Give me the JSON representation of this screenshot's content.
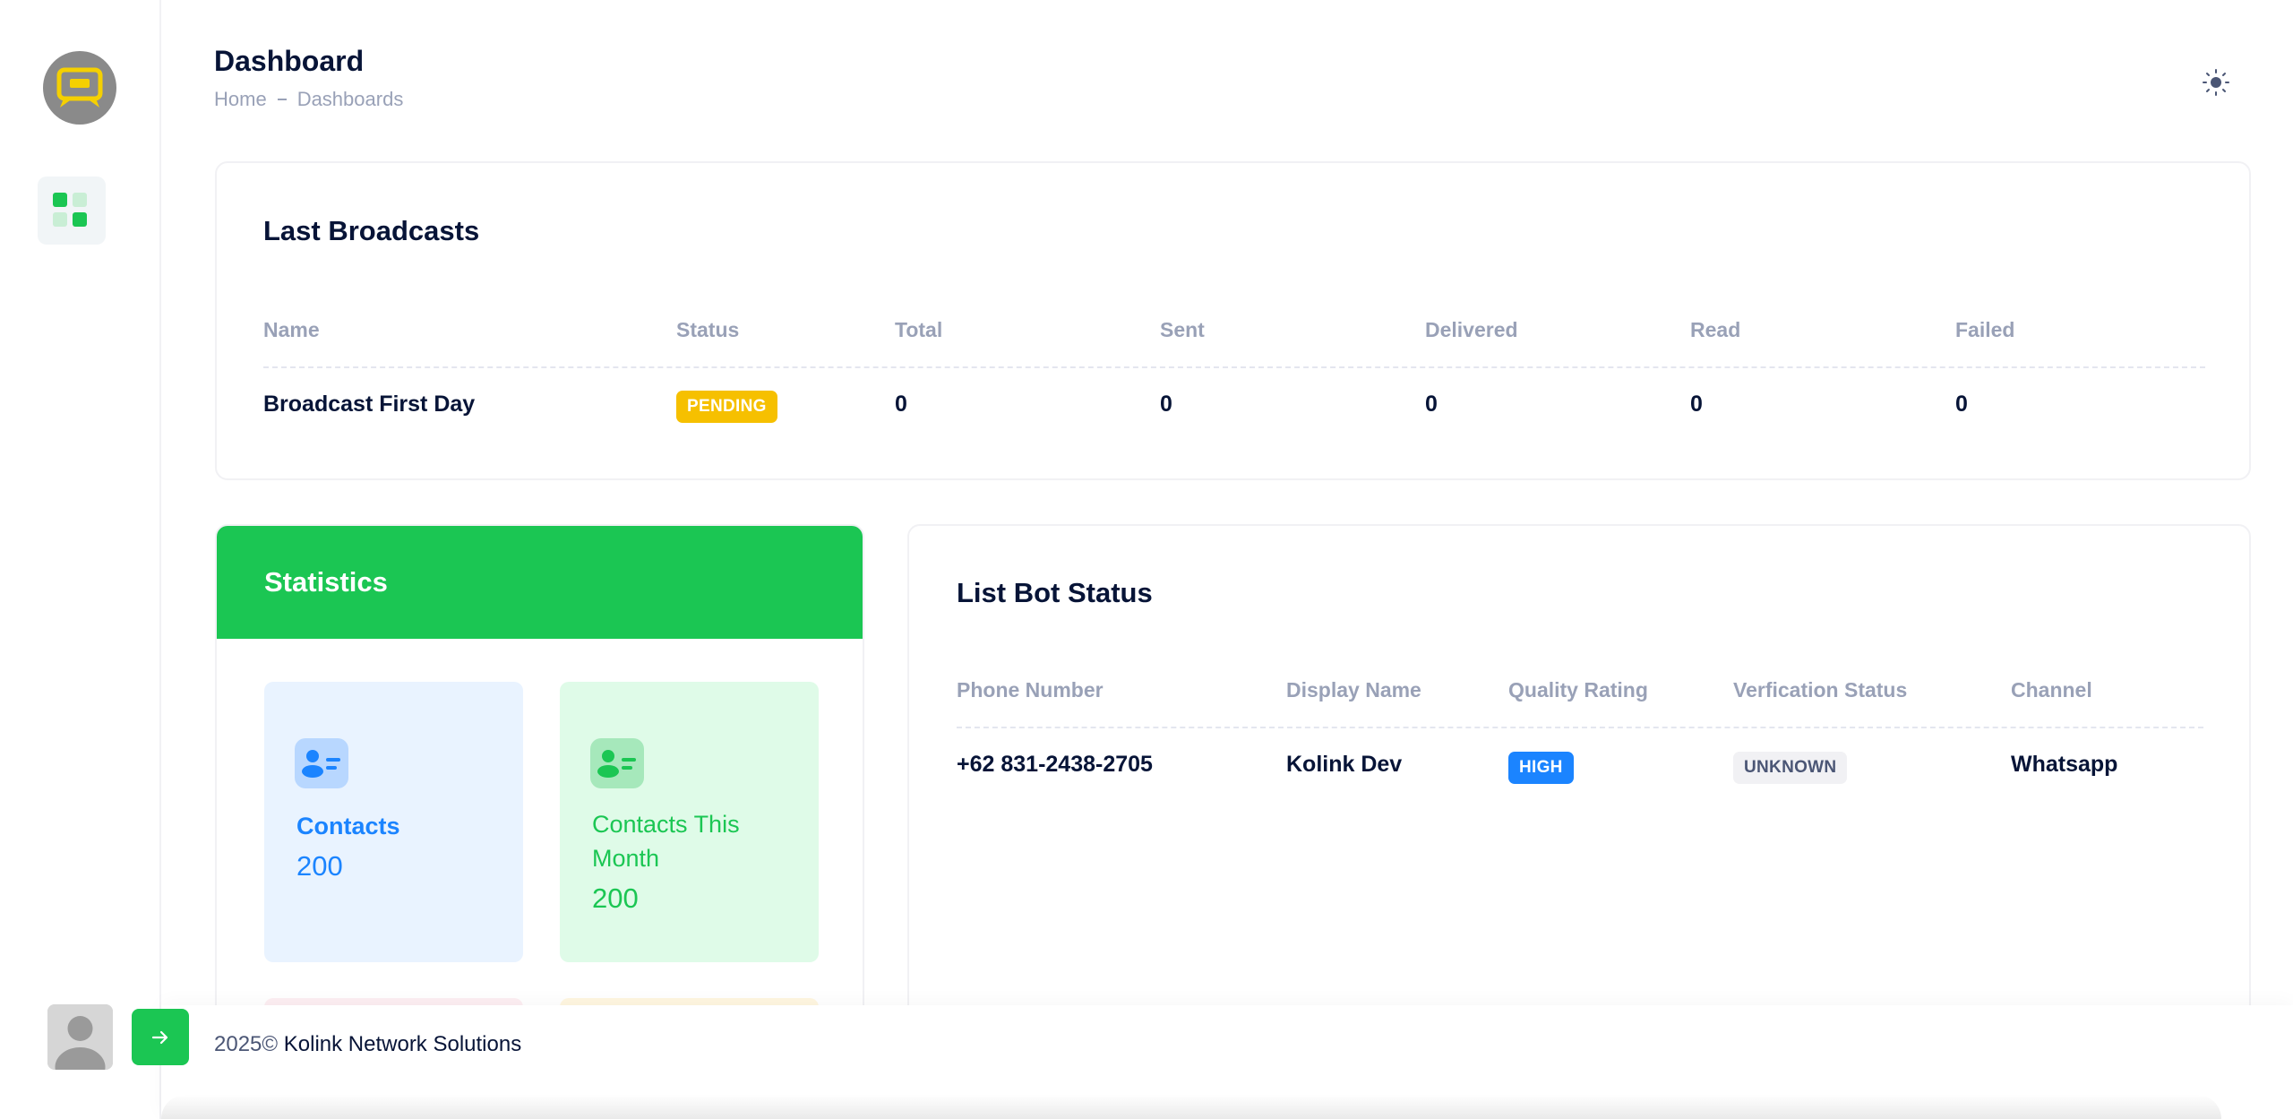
{
  "header": {
    "title": "Dashboard",
    "breadcrumb": [
      "Home",
      "Dashboards"
    ]
  },
  "broadcasts": {
    "title": "Last Broadcasts",
    "columns": [
      "Name",
      "Status",
      "Total",
      "Sent",
      "Delivered",
      "Read",
      "Failed"
    ],
    "rows": [
      {
        "name": "Broadcast First Day",
        "status": "PENDING",
        "total": "0",
        "sent": "0",
        "delivered": "0",
        "read": "0",
        "failed": "0"
      }
    ]
  },
  "statistics": {
    "title": "Statistics",
    "tiles": [
      {
        "label": "Contacts",
        "value": "200",
        "icon": "contact-card-icon"
      },
      {
        "label": "Contacts This Month",
        "value": "200",
        "icon": "contact-card-icon"
      }
    ]
  },
  "bots": {
    "title": "List Bot Status",
    "columns": [
      "Phone Number",
      "Display Name",
      "Quality Rating",
      "Verfication Status",
      "Channel"
    ],
    "rows": [
      {
        "phone": "+62 831-2438-2705",
        "display_name": "Kolink Dev",
        "quality": "HIGH",
        "verification": "UNKNOWN",
        "channel": "Whatsapp"
      }
    ]
  },
  "footer": {
    "year": "2025©",
    "company": "Kolink Network Solutions"
  },
  "colors": {
    "primary": "#1bc653",
    "dark": "#071437",
    "muted": "#99a1b7",
    "warning": "#f6c000",
    "info": "#1b84ff"
  }
}
